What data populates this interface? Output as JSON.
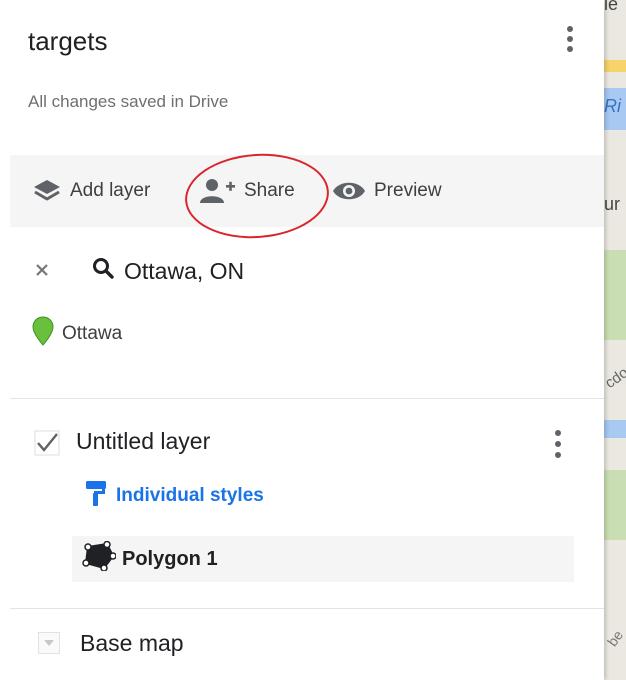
{
  "map": {
    "labels": [
      "ie",
      "Ri",
      "ur",
      "cdo",
      "be"
    ]
  },
  "header": {
    "title": "targets",
    "status": "All changes saved in Drive"
  },
  "toolbar": {
    "add_layer_label": "Add layer",
    "share_label": "Share",
    "preview_label": "Preview"
  },
  "search": {
    "query": "Ottawa, ON",
    "result_label": "Ottawa",
    "result_marker_color": "#6abf3c"
  },
  "layer": {
    "name": "Untitled layer",
    "checked": true,
    "styles_label": "Individual styles",
    "features": [
      {
        "label": "Polygon 1"
      }
    ]
  },
  "basemap": {
    "label": "Base map"
  },
  "colors": {
    "accent_blue": "#1a73e8",
    "annotation_red": "#d9262c"
  }
}
